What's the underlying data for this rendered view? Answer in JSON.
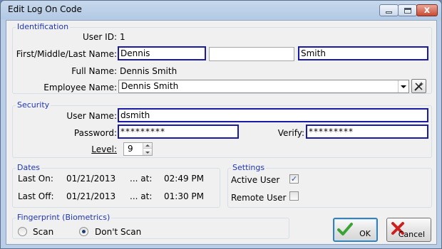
{
  "window": {
    "title": "Edit Log On Code",
    "controls": {
      "minimize": "minimize",
      "maximize": "maximize",
      "close": "x"
    }
  },
  "identification": {
    "legend": "Identification",
    "user_id_label": "User ID:",
    "user_id": "1",
    "name_label": "First/Middle/Last Name:",
    "first_name": "Dennis",
    "middle_name": "",
    "last_name": "Smith",
    "full_name_label": "Full Name:",
    "full_name": "Dennis Smith",
    "employee_label": "Employee Name:",
    "employee_name": "Dennis Smith"
  },
  "security": {
    "legend": "Security",
    "username_label": "User Name:",
    "username": "dsmith",
    "password_label": "Password:",
    "password": "*********",
    "verify_label": "Verify:",
    "verify": "*********",
    "level_label": "Level:",
    "level": "9"
  },
  "dates": {
    "legend": "Dates",
    "last_on_label": "Last On:",
    "last_on_date": "01/21/2013",
    "last_on_at": "... at:",
    "last_on_time": "02:49 PM",
    "last_off_label": "Last Off:",
    "last_off_date": "01/21/2013",
    "last_off_at": "... at:",
    "last_off_time": "01:30 PM"
  },
  "settings": {
    "legend": "Settings",
    "active_user_label": "Active User",
    "active_user_checked": true,
    "remote_user_label": "Remote User",
    "remote_user_checked": false
  },
  "fingerprint": {
    "legend": "Fingerprint (Biometrics)",
    "scan_label": "Scan",
    "dont_scan_label": "Don't Scan",
    "selected": "dont_scan"
  },
  "buttons": {
    "ok": "OK",
    "cancel": "Cancel"
  },
  "icons": {
    "ok": "green-checkmark-icon",
    "cancel": "red-x-icon",
    "clear_employee": "clear-wand-icon"
  },
  "colors": {
    "accent_border": "#1a1aa5",
    "legend_text": "#1d36b8",
    "ok_icon": "#3aa335",
    "cancel_icon": "#cc1f1f"
  }
}
